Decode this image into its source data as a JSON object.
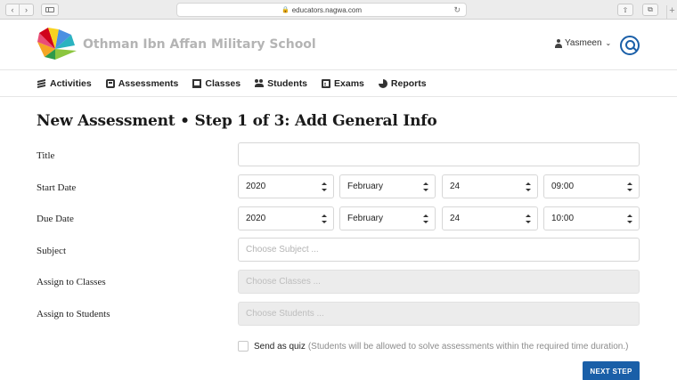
{
  "browser": {
    "url": "educators.nagwa.com",
    "back_icon": "chevron-left-icon",
    "forward_icon": "chevron-right-icon"
  },
  "header": {
    "school_name": "Othman Ibn Affan Military School",
    "user_name": "Yasmeen"
  },
  "nav": {
    "items": [
      {
        "label": "Activities",
        "icon": "layers-icon"
      },
      {
        "label": "Assessments",
        "icon": "assessment-icon"
      },
      {
        "label": "Classes",
        "icon": "classes-icon"
      },
      {
        "label": "Students",
        "icon": "students-icon"
      },
      {
        "label": "Exams",
        "icon": "exam-icon"
      },
      {
        "label": "Reports",
        "icon": "pie-chart-icon"
      }
    ]
  },
  "form": {
    "heading": "New Assessment • Step 1 of 3: Add General Info",
    "title_label": "Title",
    "title_value": "",
    "start_label": "Start Date",
    "start": {
      "year": "2020",
      "month": "February",
      "day": "24",
      "time": "09:00"
    },
    "due_label": "Due Date",
    "due": {
      "year": "2020",
      "month": "February",
      "day": "24",
      "time": "10:00"
    },
    "subject_label": "Subject",
    "subject_placeholder": "Choose Subject ...",
    "classes_label": "Assign to Classes",
    "classes_placeholder": "Choose Classes ...",
    "students_label": "Assign to Students",
    "students_placeholder": "Choose Students ...",
    "quiz_label": "Send as quiz",
    "quiz_hint": "(Students will be allowed to solve assessments within the required time duration.)",
    "quiz_checked": false,
    "next_label": "NEXT STEP"
  },
  "colors": {
    "accent": "#1a5fa8",
    "school_name": "#b4b4b4"
  }
}
